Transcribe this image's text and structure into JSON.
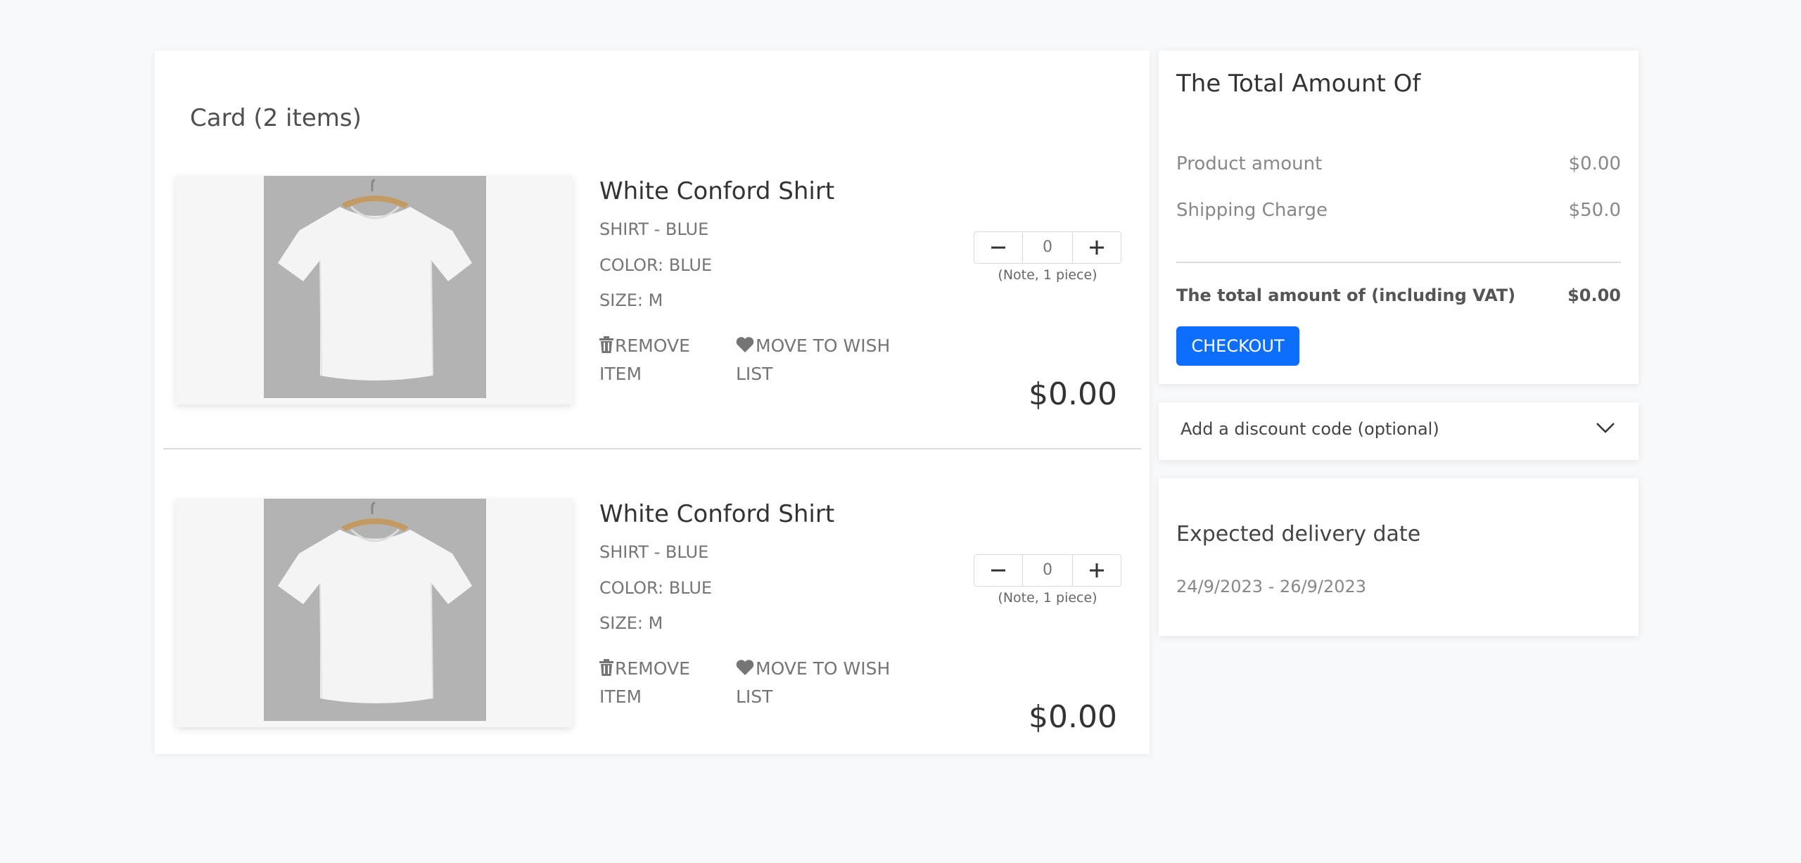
{
  "cart": {
    "title": "Card (2 items)",
    "items": [
      {
        "name": "White Conford Shirt",
        "type": "SHIRT - BLUE",
        "color": "COLOR: BLUE",
        "size": "SIZE: M",
        "remove_label": "REMOVE ITEM",
        "wishlist_label": "MOVE TO WISH LIST",
        "quantity": "0",
        "quantity_note": "(Note, 1 piece)",
        "price": "$0.00",
        "image": "white-tshirt-on-hanger"
      },
      {
        "name": "White Conford Shirt",
        "type": "SHIRT - BLUE",
        "color": "COLOR: BLUE",
        "size": "SIZE: M",
        "remove_label": "REMOVE ITEM",
        "wishlist_label": "MOVE TO WISH LIST",
        "quantity": "0",
        "quantity_note": "(Note, 1 piece)",
        "price": "$0.00",
        "image": "white-tshirt-on-hanger"
      }
    ]
  },
  "summary": {
    "title": "The Total Amount Of",
    "product_label": "Product amount",
    "product_value": "$0.00",
    "shipping_label": "Shipping Charge",
    "shipping_value": "$50.0",
    "total_label": "The total amount of (including VAT)",
    "total_value": "$0.00",
    "checkout_label": "CHECKOUT"
  },
  "discount": {
    "label": "Add a discount code (optional)"
  },
  "delivery": {
    "title": "Expected delivery date",
    "date_range": "24/9/2023 - 26/9/2023"
  },
  "icons": {
    "remove": "trash-icon",
    "wishlist": "heart-icon",
    "minus": "minus-icon",
    "plus": "plus-icon",
    "chevron": "chevron-down-icon"
  },
  "colors": {
    "accent": "#0d6efd",
    "background": "#f8f9fa",
    "card": "#ffffff"
  }
}
